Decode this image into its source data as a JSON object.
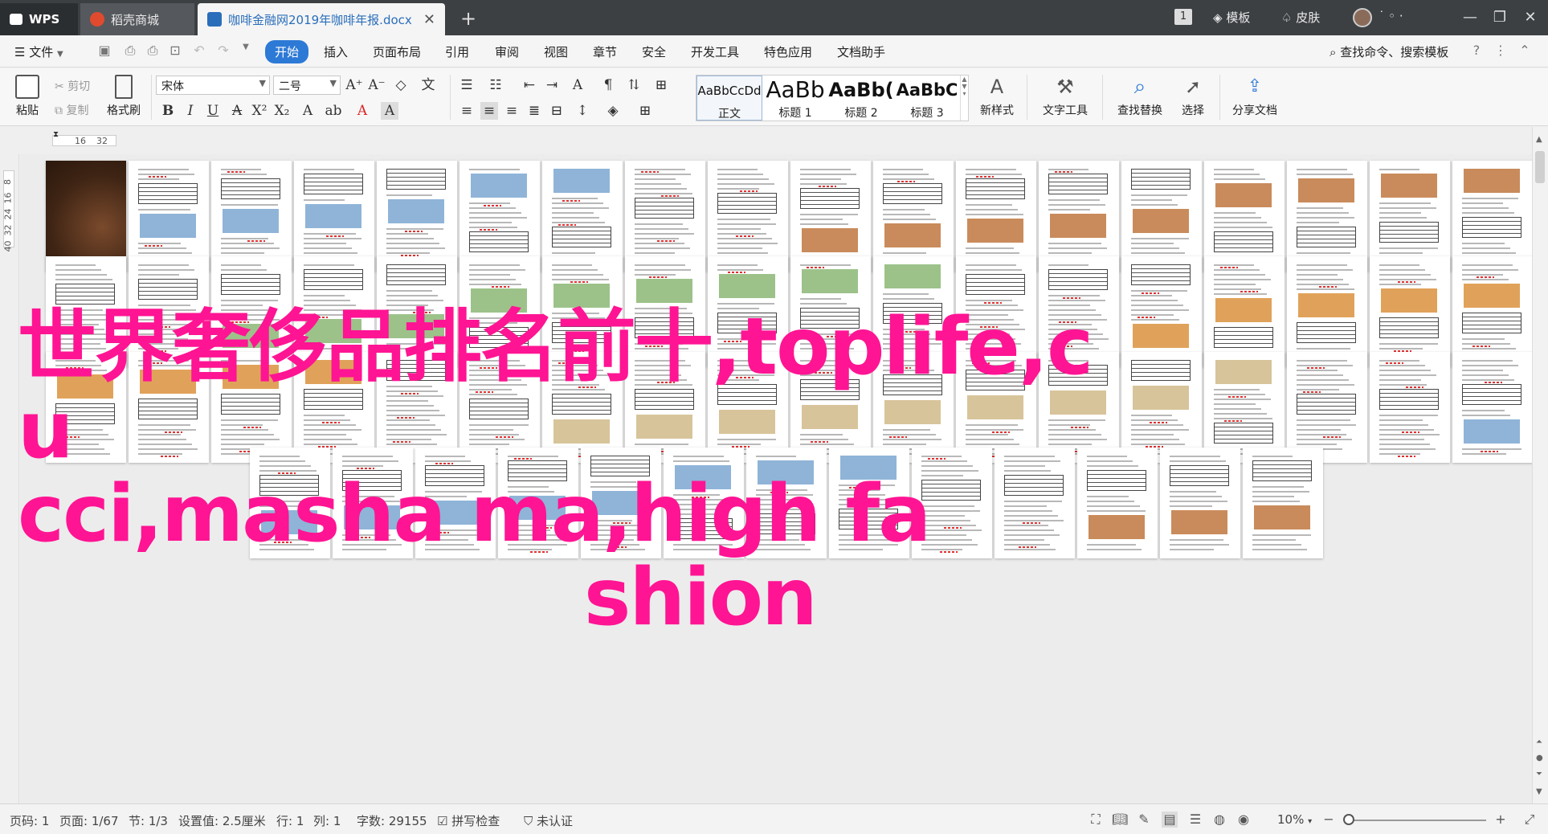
{
  "titlebar": {
    "wps_tab": "WPS",
    "shop_tab": "稻壳商城",
    "doc_tab": "咖啡金融网2019年咖啡年报.docx",
    "badge": "1",
    "template_label": "模板",
    "skin_label": "皮肤"
  },
  "menubar": {
    "file": "文件",
    "tabs": [
      "开始",
      "插入",
      "页面布局",
      "引用",
      "审阅",
      "视图",
      "章节",
      "安全",
      "开发工具",
      "特色应用",
      "文档助手"
    ],
    "search": "查找命令、搜索模板"
  },
  "ribbon": {
    "paste": "粘贴",
    "cut": "剪切",
    "copy": "复制",
    "format_painter": "格式刷",
    "font_name": "宋体",
    "font_size": "二号",
    "styles": [
      {
        "sample": "AaBbCcDd",
        "name": "正文"
      },
      {
        "sample": "AaBb",
        "name": "标题 1"
      },
      {
        "sample": "AaBb(",
        "name": "标题 2"
      },
      {
        "sample": "AaBbC",
        "name": "标题 3"
      }
    ],
    "new_style": "新样式",
    "text_tools": "文字工具",
    "find_replace": "查找替换",
    "select": "选择",
    "share_doc": "分享文档"
  },
  "ruler": {
    "h_marks": [
      "16",
      "32"
    ],
    "v_marks": [
      "8",
      "16",
      "24",
      "32",
      "40"
    ]
  },
  "overlay": {
    "line1": "世界奢侈品排名前十,toplife,cu",
    "line2": "cci,masha ma,high fa",
    "line3": "shion"
  },
  "statusbar": {
    "page_no": "页码: 1",
    "page_count": "页面: 1/67",
    "section": "节: 1/3",
    "setting": "设置值: 2.5厘米",
    "row": "行: 1",
    "col": "列: 1",
    "word_count": "字数: 29155",
    "spell_check": "拼写检查",
    "uncertified": "未认证",
    "zoom": "10%"
  },
  "colors": {
    "accent": "#2d79d6",
    "overlay_text": "#ff1493",
    "titlebar": "#3c4043"
  }
}
